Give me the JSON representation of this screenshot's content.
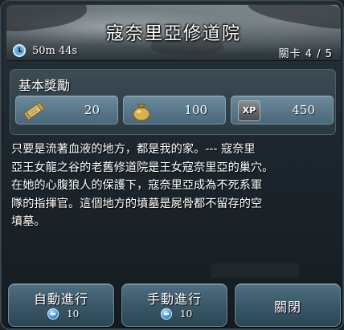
{
  "header": {
    "title": "寇奈里亞修道院",
    "timer": "50m 44s",
    "timer_icon": "clock-icon",
    "stage": "關卡 4 / 5"
  },
  "rewards": {
    "title": "基本獎勵",
    "items": [
      {
        "icon": "scroll-icon",
        "value": "20"
      },
      {
        "icon": "money-bag-icon",
        "value": "100"
      },
      {
        "icon": "xp-icon",
        "label": "XP",
        "value": "450"
      }
    ]
  },
  "description": {
    "lines": [
      "只要是流著血液的地方，都是我的家。--- 寇奈里",
      "亞王女龍之谷的老舊修道院是王女寇奈里亞的巢穴。",
      "在她的心腹狼人的保護下，寇奈里亞成為不死系軍",
      "隊的指揮官。這個地方的墳墓是屍骨都不留存的空",
      "墳墓。"
    ]
  },
  "buttons": {
    "auto": {
      "label": "自動進行",
      "cost": "10",
      "cost_icon": "gem-icon"
    },
    "manual": {
      "label": "手動進行",
      "cost": "10",
      "cost_icon": "gem-icon"
    },
    "close": {
      "label": "關閉"
    }
  },
  "colors": {
    "panel_bg": "#2a3840",
    "reward_box": "#5b7a8b",
    "button": "#3a5869",
    "text": "#ffffff"
  }
}
